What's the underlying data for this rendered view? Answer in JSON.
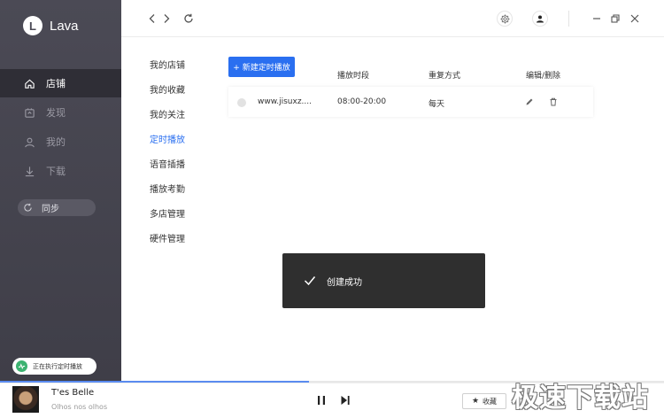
{
  "app": {
    "logo_letter": "L",
    "logo_text": "Lava"
  },
  "sidebar": {
    "items": [
      {
        "label": "店铺",
        "icon": "home-icon",
        "active": true
      },
      {
        "label": "发现",
        "icon": "discover-icon",
        "active": false
      },
      {
        "label": "我的",
        "icon": "user-icon",
        "active": false
      },
      {
        "label": "下载",
        "icon": "download-icon",
        "active": false
      }
    ],
    "sync_label": "同步",
    "running_label": "正在执行定时播放"
  },
  "subnav": {
    "items": [
      "我的店铺",
      "我的收藏",
      "我的关注",
      "定时播放",
      "语音插播",
      "播放考勤",
      "多店管理",
      "硬件管理"
    ],
    "active_index": 3
  },
  "content": {
    "new_button": "+ 新建定时播放",
    "columns": {
      "time": "播放时段",
      "repeat": "重复方式",
      "actions": "编辑/删除"
    },
    "rows": [
      {
        "name": "www.jisuxz....",
        "time": "08:00-20:00",
        "repeat": "每天"
      }
    ]
  },
  "toast": {
    "message": "创建成功"
  },
  "player": {
    "title": "T'es Belle",
    "artist": "Olhos nos olhos",
    "fav_label": "收藏",
    "progress": 0.465
  },
  "watermark": "极速下载站",
  "colors": {
    "accent": "#2a6ff0",
    "sidebar": "#4b4a55",
    "active_nav": "#2f2e36",
    "toast": "#2f2f2f"
  }
}
